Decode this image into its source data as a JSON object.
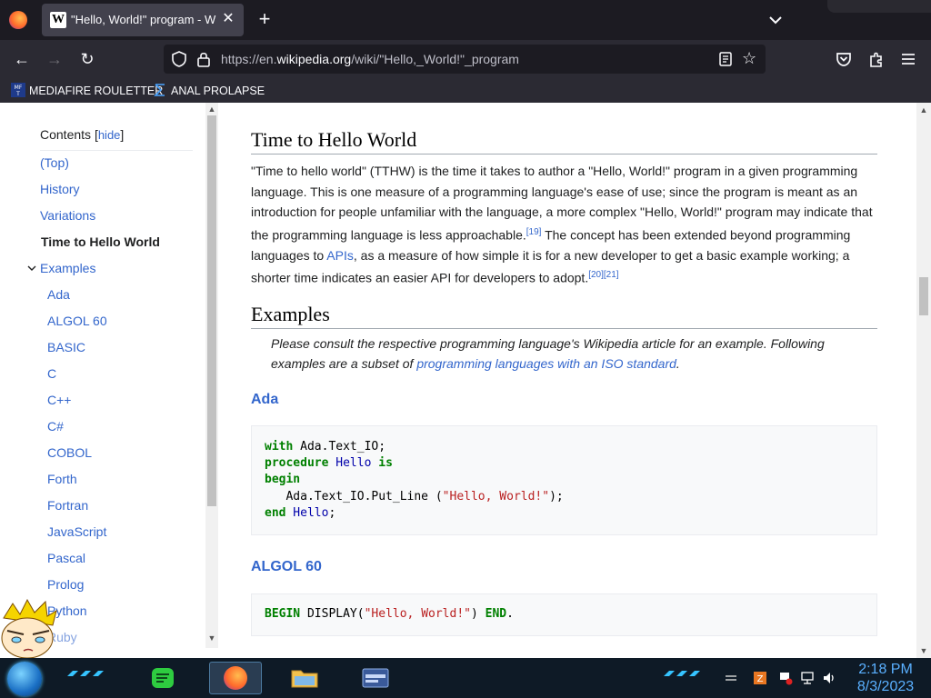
{
  "browser": {
    "tab_title": "\"Hello, World!\" program - Wiki",
    "tab_favicon": "W",
    "url_prefix": "https://en.",
    "url_domain": "wikipedia.org",
    "url_path": "/wiki/\"Hello,_World!\"_program",
    "bookmarks": [
      {
        "label": "MEDIAFIRE ROULETTER"
      },
      {
        "label": "ANAL PROLAPSE"
      }
    ]
  },
  "toc": {
    "title": "Contents",
    "hide_label": "hide",
    "items": [
      {
        "label": "(Top)"
      },
      {
        "label": "History"
      },
      {
        "label": "Variations"
      },
      {
        "label": "Time to Hello World"
      },
      {
        "label": "Examples"
      },
      {
        "label": "Ada"
      },
      {
        "label": "ALGOL 60"
      },
      {
        "label": "BASIC"
      },
      {
        "label": "C"
      },
      {
        "label": "C++"
      },
      {
        "label": "C#"
      },
      {
        "label": "COBOL"
      },
      {
        "label": "Forth"
      },
      {
        "label": "Fortran"
      },
      {
        "label": "JavaScript"
      },
      {
        "label": "Pascal"
      },
      {
        "label": "Prolog"
      },
      {
        "label": "Python"
      },
      {
        "label": "Ruby"
      }
    ]
  },
  "article": {
    "section_tthw": "Time to Hello World",
    "tthw_p1": "\"Time to hello world\" (TTHW) is the time it takes to author a \"Hello, World!\" program in a given programming language. This is one measure of a programming language's ease of use; since the program is meant as an introduction for people unfamiliar with the language, a more complex \"Hello, World!\" program may indicate that the programming language is less approachable.",
    "ref19": "[19]",
    "tthw_p2": " The concept has been extended beyond programming languages to ",
    "apis_link": "APIs",
    "tthw_p3": ", as a measure of how simple it is for a new developer to get a basic example working; a shorter time indicates an easier API for developers to adopt.",
    "ref2021": "[20][21]",
    "section_examples": "Examples",
    "hatnote_1": "Please consult the respective programming language's Wikipedia article for an example. Following examples are a subset of ",
    "hatnote_link": "programming languages with an ISO standard",
    "hatnote_2": ".",
    "ada_heading": "Ada",
    "algol_heading": "ALGOL 60",
    "ada_code": {
      "l1_kw": "with",
      "l1_rest": " Ada.Text_IO;",
      "l2_kw": "procedure",
      "l2_name": " Hello",
      "l2_kw2": " is",
      "l3_kw": "begin",
      "l4_pre": "   Ada.Text_IO.Put_Line (",
      "l4_str": "\"Hello, World!\"",
      "l4_post": ");",
      "l5_kw": "end",
      "l5_name": " Hello",
      "l5_post": ";"
    },
    "algol_code": {
      "kw1": "BEGIN",
      "mid": " DISPLAY(",
      "str": "\"Hello, World!\"",
      "post": ") ",
      "kw2": "END",
      "end": "."
    }
  },
  "taskbar": {
    "time": "2:18 PM",
    "date": "8/3/2023"
  },
  "colors": {
    "link": "#3366cc",
    "chrome_dark": "#1c1b22",
    "chrome": "#2b2a33",
    "clock": "#5ab0ff"
  }
}
